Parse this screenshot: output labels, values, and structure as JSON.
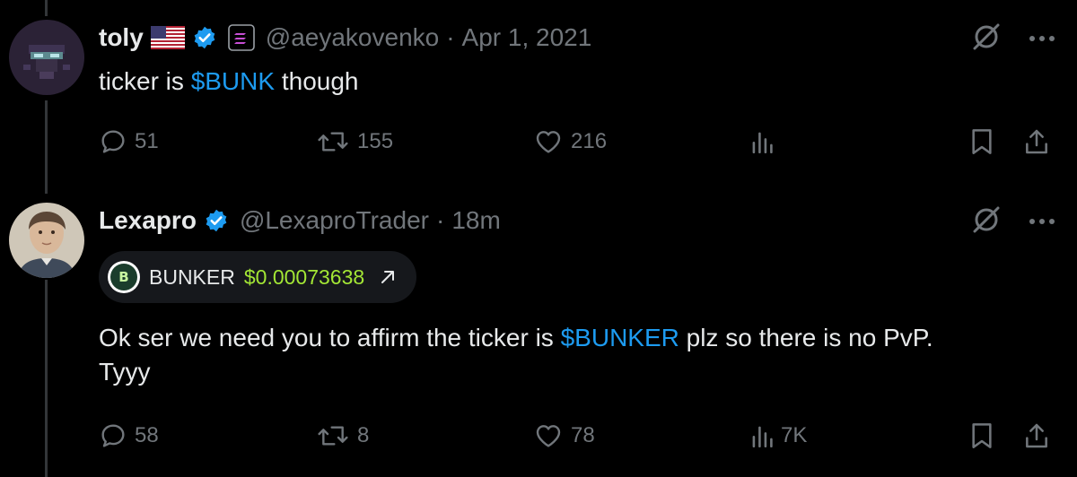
{
  "colors": {
    "background": "#000000",
    "text": "#e7e9ea",
    "muted": "#71767b",
    "cashtag": "#1d9bf0",
    "verified": "#1d9bf0",
    "price": "#a3e635"
  },
  "tweets": [
    {
      "display_name": "toly",
      "flag_icon": "us-flag-icon",
      "verified_icon": "verified-badge-icon",
      "affiliate_icon": "solana-affiliate-icon",
      "handle": "@aeyakovenko",
      "separator": "·",
      "timestamp": "Apr 1, 2021",
      "text_before": "ticker is ",
      "cashtag": "$BUNK",
      "text_after": " though",
      "text_line2": "",
      "stats": {
        "replies": "51",
        "retweets": "155",
        "likes": "216",
        "views": ""
      }
    },
    {
      "display_name": "Lexapro",
      "verified_icon": "verified-badge-icon",
      "handle": "@LexaproTrader",
      "separator": "·",
      "timestamp": "18m",
      "token": {
        "logo_text": "B",
        "name": "BUNKER",
        "price": "$0.00073638",
        "arrow_icon": "external-arrow-icon"
      },
      "text_before": "Ok ser we need you to affirm the ticker is ",
      "cashtag": "$BUNKER",
      "text_after": " plz so there is no PvP.",
      "text_line2": "Tyyy",
      "stats": {
        "replies": "58",
        "retweets": "8",
        "likes": "78",
        "views": "7K"
      }
    }
  ]
}
